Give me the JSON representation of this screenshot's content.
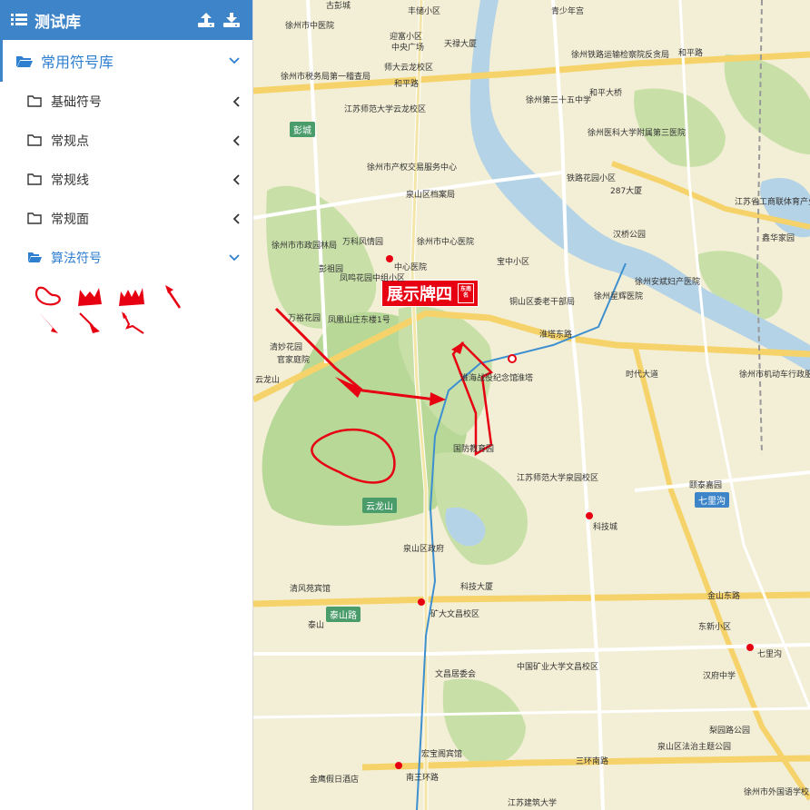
{
  "sidebar": {
    "title": "测试库",
    "upload_label": "上传",
    "download_label": "下载",
    "group": {
      "label": "常用符号库",
      "expanded": true
    },
    "items": [
      {
        "label": "基础符号",
        "expanded": false
      },
      {
        "label": "常规点",
        "expanded": false
      },
      {
        "label": "常规线",
        "expanded": false
      },
      {
        "label": "常规面",
        "expanded": false
      },
      {
        "label": "算法符号",
        "expanded": true
      }
    ],
    "symbols": [
      "closed-curve-icon",
      "double-tail-arrow-icon",
      "triple-tail-arrow-icon",
      "thin-arrow-icon",
      "straight-arrow-icon",
      "tailed-arrow-icon",
      "swallowtail-arrow-icon"
    ],
    "accent": "#3d84c8",
    "symbol_color": "#e60012"
  },
  "map": {
    "showboard": {
      "title": "展示牌四",
      "seal": "东南名"
    },
    "labels": [
      {
        "t": "古彭城"
      },
      {
        "t": "丰储小区"
      },
      {
        "t": "青少年宫"
      },
      {
        "t": "徐州市中医院"
      },
      {
        "t": "迎富小区"
      },
      {
        "t": "中央广场"
      },
      {
        "t": "天禄大厦"
      },
      {
        "t": "徐州铁路运输检察院反贪局"
      },
      {
        "t": "和平路"
      },
      {
        "t": "师大云龙校区"
      },
      {
        "t": "和平路"
      },
      {
        "t": "和平大桥"
      },
      {
        "t": "彭城"
      },
      {
        "t": "江苏师范大学云龙校区"
      },
      {
        "t": "徐州第三十五中学"
      },
      {
        "t": "徐州医科大学附属第三医院"
      },
      {
        "t": "徐州市税务局第一稽查局"
      },
      {
        "t": "徐州市产权交易服务中心"
      },
      {
        "t": "泉山区档案局"
      },
      {
        "t": "徐州市中心医院"
      },
      {
        "t": "中心医院"
      },
      {
        "t": "铁路花园小区"
      },
      {
        "t": "287大厦"
      },
      {
        "t": "万科风情园"
      },
      {
        "t": "彭祖园"
      },
      {
        "t": "凤鸣花园中组小区"
      },
      {
        "t": "宝中小区"
      },
      {
        "t": "铜山区委老干部局"
      },
      {
        "t": "汉桥公园"
      },
      {
        "t": "江苏省工商联体育产业商会"
      },
      {
        "t": "徐州市市政园林局"
      },
      {
        "t": "万裕花园"
      },
      {
        "t": "凤凰山庄东楼1号"
      },
      {
        "t": "清妙花园"
      },
      {
        "t": "官家庭院"
      },
      {
        "t": "淮塔东路"
      },
      {
        "t": "淮塔"
      },
      {
        "t": "云龙山"
      },
      {
        "t": "徐州安斌妇产医院"
      },
      {
        "t": "徐州星辉医院"
      },
      {
        "t": "徐州市机动车行政服务中心"
      },
      {
        "t": "国防教育园"
      },
      {
        "t": "淮海战役纪念馆"
      },
      {
        "t": "泰山路"
      },
      {
        "t": "江苏师范大学泉园校区"
      },
      {
        "t": "颐泰嘉园"
      },
      {
        "t": "七里沟"
      },
      {
        "t": "科技城"
      },
      {
        "t": "泉山区政府"
      },
      {
        "t": "科技大厦"
      },
      {
        "t": "清风苑宾馆"
      },
      {
        "t": "泰山"
      },
      {
        "t": "矿大文昌校区"
      },
      {
        "t": "金山东路"
      },
      {
        "t": "七里沟"
      },
      {
        "t": "中国矿业大学文昌校区"
      },
      {
        "t": "文昌居委会"
      },
      {
        "t": "三环南路"
      },
      {
        "t": "南三环路"
      },
      {
        "t": "金鹰假日酒店"
      },
      {
        "t": "宏宝阁宾馆"
      },
      {
        "t": "泉山区法治主题公园"
      },
      {
        "t": "梨园路公园"
      },
      {
        "t": "徐州市外国语学校"
      },
      {
        "t": "江苏建筑大学"
      },
      {
        "t": "云龙山"
      },
      {
        "t": "鑫华家园"
      },
      {
        "t": "东新小区"
      },
      {
        "t": "汉府中学"
      },
      {
        "t": "时代大道"
      }
    ]
  }
}
